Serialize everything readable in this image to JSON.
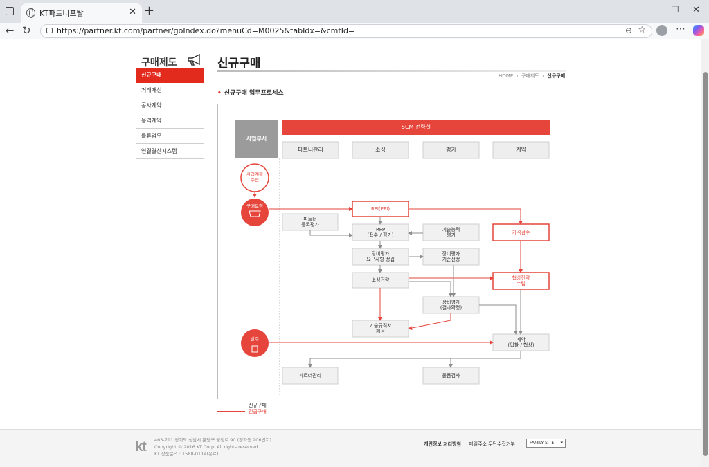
{
  "browser": {
    "tab_title": "KT파트너포탈",
    "url": "https://partner.kt.com/partner/goIndex.do?menuCd=M0025&tabIdx=&cmtId="
  },
  "sidebar": {
    "title": "구매제도",
    "items": [
      {
        "label": "신규구매",
        "active": true
      },
      {
        "label": "거래개선"
      },
      {
        "label": "공사계약"
      },
      {
        "label": "용역계약"
      },
      {
        "label": "물류업무"
      },
      {
        "label": "연결결산시스템"
      }
    ]
  },
  "page": {
    "title": "신규구매",
    "breadcrumb": [
      "HOME",
      "구매제도",
      "신규구매"
    ],
    "subtitle": "신규구매 업무프로세스"
  },
  "diagram": {
    "headers": {
      "dept": "사업부서",
      "scm": "SCM 전략실",
      "partner_mgmt": "파트너관리",
      "sourcing": "소싱",
      "evaluation": "평가",
      "contract": "계약"
    },
    "nodes": {
      "plan": "사업계획\n수립",
      "request": "구매요청",
      "order": "발주",
      "rfi": "RFI(EPI)",
      "partner_reg": "파트너\n등록평가",
      "rfp": "RFP\n(접수 / 평가)",
      "tech_eval": "기술능력\n평가",
      "price_check": "가격검수",
      "equip_req": "장비평가\n요구사항 정립",
      "equip_std": "장비평가\n기준선정",
      "sourcing_strategy": "소싱전략",
      "nego_strategy": "협상전략\n수립",
      "equip_result": "장비평가\n(결과확정)",
      "tech_spec": "기술규격서\n제정",
      "contract": "계약\n(입찰 / 협상)",
      "partner_mgmt": "파트너관리",
      "inspection": "물품검사"
    },
    "colors": {
      "red": "#e5453b",
      "gray": "#8c8c8c",
      "box_fill": "#f1f1f1"
    }
  },
  "legend": [
    {
      "label": "신규구매",
      "color": "#666666"
    },
    {
      "label": "긴급구매",
      "color": "#e5453b"
    }
  ],
  "footer": {
    "logo": "kt",
    "address_lines": [
      "463-711 경기도 성남시 분당구 불정로 90 (정자동 206번지)",
      "Copyright © 2016 KT Corp. All rights reserved.",
      "KT 상품문의 : 1588-0114(유료)"
    ],
    "link_privacy": "개인정보 처리방침",
    "link_email": "메일주소 무단수집거부",
    "family_site": "FAMILY SITE"
  }
}
